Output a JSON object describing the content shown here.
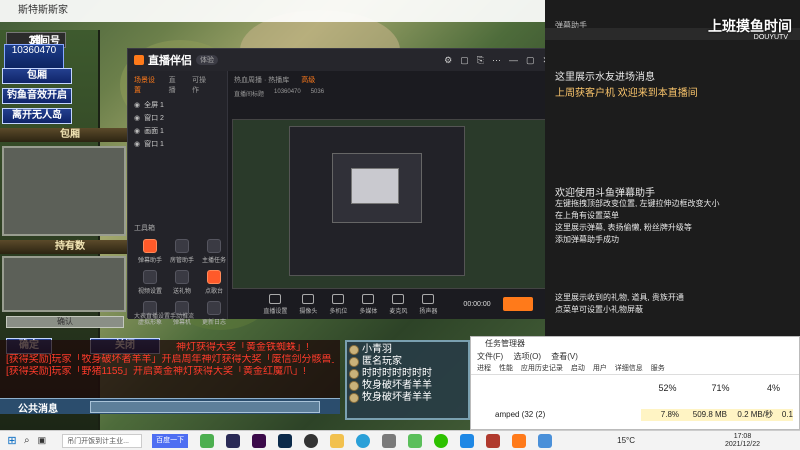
{
  "game": {
    "window_title": "斯特斯斯家",
    "room_label": "房间号",
    "room_number": "10360470",
    "buttons": [
      "包厢",
      "钓鱼音效开启",
      "离开无人岛"
    ],
    "section_room": "包厢",
    "section_hold": "持有数",
    "confirm_text": "确认",
    "ok_label": "确定",
    "close_label": "关闭",
    "chat_lines": [
      "神灯获得大奖「黄金铁蜘蛛」!",
      "[获得奖励]玩家「牧身破坏者羊羊」开启周年神灯获得大奖「废信剑分骸兽」!",
      "[获得奖励]玩家「野猪1155」开启黄金神灯获得大奖「黄金红魔爪」!"
    ],
    "players": [
      "小青羽",
      "匿名玩家",
      "时时时时时时时",
      "牧身破坏者羊羊",
      "牧身破坏者羊羊"
    ],
    "public_msg": "公共消息"
  },
  "app": {
    "logo": "直播伴侣",
    "tag": "体验",
    "left_tabs": [
      "场景设置",
      "直播",
      "可操作"
    ],
    "scenes": [
      "全屏 1",
      "窗口 2",
      "画面 1",
      "窗口 1"
    ],
    "toolbox_label": "工具箱",
    "tools": [
      "弹幕助手",
      "房管助手",
      "主播任务",
      "视频设置",
      "送礼物",
      "点歌台",
      "虚拟形象",
      "弹幕机",
      "更新日志"
    ],
    "main_tabs": [
      "热血周播 · 热播库",
      "高级"
    ],
    "stream_title": "直播间标题",
    "room_id": "10360470",
    "viewers": "5036",
    "bottom_tools": [
      "直播设置",
      "摄像头",
      "多机位",
      "多媒体",
      "麦克风",
      "扬声器"
    ],
    "status": "大表直播设置手动推流",
    "time": "00:00:00"
  },
  "danmu": {
    "header": "弹幕助手",
    "lines": [
      "这里展示水友进场消息",
      "上周获客户机 欢迎来到本直播间",
      "欢迎使用斗鱼弹幕助手",
      "左键拖拽顶部改变位置, 左键拉伸边框改变大小",
      "在上角有设置菜单",
      "这里展示弹幕, 表扬偷懒, 粉丝牌升级等",
      "添加弹幕助手成功",
      "这里展示收到的礼物, 道具, 贵族开通",
      "点菜单可设置小礼物屏蔽"
    ],
    "watermark": "上班摸鱼时间",
    "watermark_sub": "DOUYUTV"
  },
  "taskman": {
    "title": "任务管理器",
    "menu": [
      "文件(F)",
      "选项(O)",
      "查看(V)"
    ],
    "tabs": [
      "进程",
      "性能",
      "应用历史记录",
      "启动",
      "用户",
      "详细信息",
      "服务"
    ],
    "stats": [
      "52%",
      "71%",
      "4%"
    ],
    "row": {
      "name": "amped (32 (2)",
      "cpu": "7.8%",
      "mem": "509.8 MB",
      "disk": "0.2 MB/秒",
      "net": "0.1"
    }
  },
  "taskbar": {
    "search_placeholder": "吊门开饭到计主业...",
    "baidu": "百度一下",
    "temperature": "15°C",
    "time": "17:08",
    "date": "2021/12/22"
  }
}
